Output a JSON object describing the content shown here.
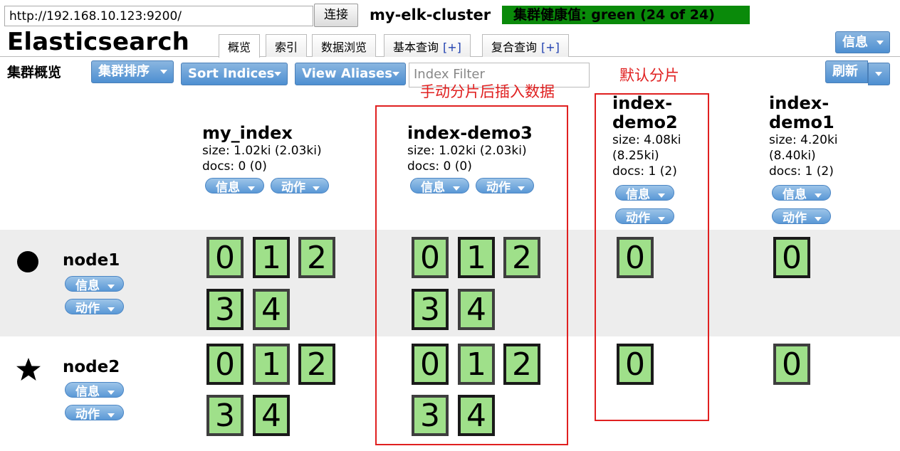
{
  "header": {
    "url": "http://192.168.10.123:9200/",
    "connect_label": "连接",
    "cluster_name": "my-elk-cluster",
    "health": "集群健康值: green (24 of 24)",
    "brand": "Elasticsearch",
    "info_label": "信息",
    "tabs": [
      {
        "label": "概览",
        "plus": ""
      },
      {
        "label": "索引",
        "plus": ""
      },
      {
        "label": "数据浏览",
        "plus": ""
      },
      {
        "label": "基本查询",
        "plus": "[+]"
      },
      {
        "label": "复合查询",
        "plus": "[+]"
      }
    ]
  },
  "toolbar": {
    "title": "集群概览",
    "cluster_sort": "集群排序",
    "sort_indices": "Sort Indices",
    "view_aliases": "View Aliases",
    "filter_placeholder": "Index Filter",
    "refresh": "刷新"
  },
  "annotations": {
    "default_shards": "默认分片",
    "manual_shards": "手动分片后插入数据"
  },
  "buttons": {
    "info": "信息",
    "action": "动作"
  },
  "indices": [
    {
      "name": "my_index",
      "size": "size: 1.02ki (2.03ki)",
      "docs": "docs: 0 (0)"
    },
    {
      "name": "index-demo3",
      "size": "size: 1.02ki (2.03ki)",
      "docs": "docs: 0 (0)"
    },
    {
      "name_l1": "index-",
      "name_l2": "demo2",
      "size_l1": "size: 4.08ki",
      "size_l2": "(8.25ki)",
      "docs": "docs: 1 (2)"
    },
    {
      "name_l1": "index-",
      "name_l2": "demo1",
      "size_l1": "size: 4.20ki",
      "size_l2": "(8.40ki)",
      "docs": "docs: 1 (2)"
    }
  ],
  "nodes": [
    {
      "name": "node1",
      "marker": "master-node-circle-icon"
    },
    {
      "name": "node2",
      "marker": "star-icon"
    }
  ],
  "shards": {
    "five": [
      "0",
      "1",
      "2",
      "3",
      "4"
    ],
    "one": [
      "0"
    ]
  },
  "colors": {
    "health_bg": "#0a8a0a",
    "shard_bg": "#9fe08a",
    "button_blue": "#5a98d6",
    "annotation_red": "#e02020"
  }
}
